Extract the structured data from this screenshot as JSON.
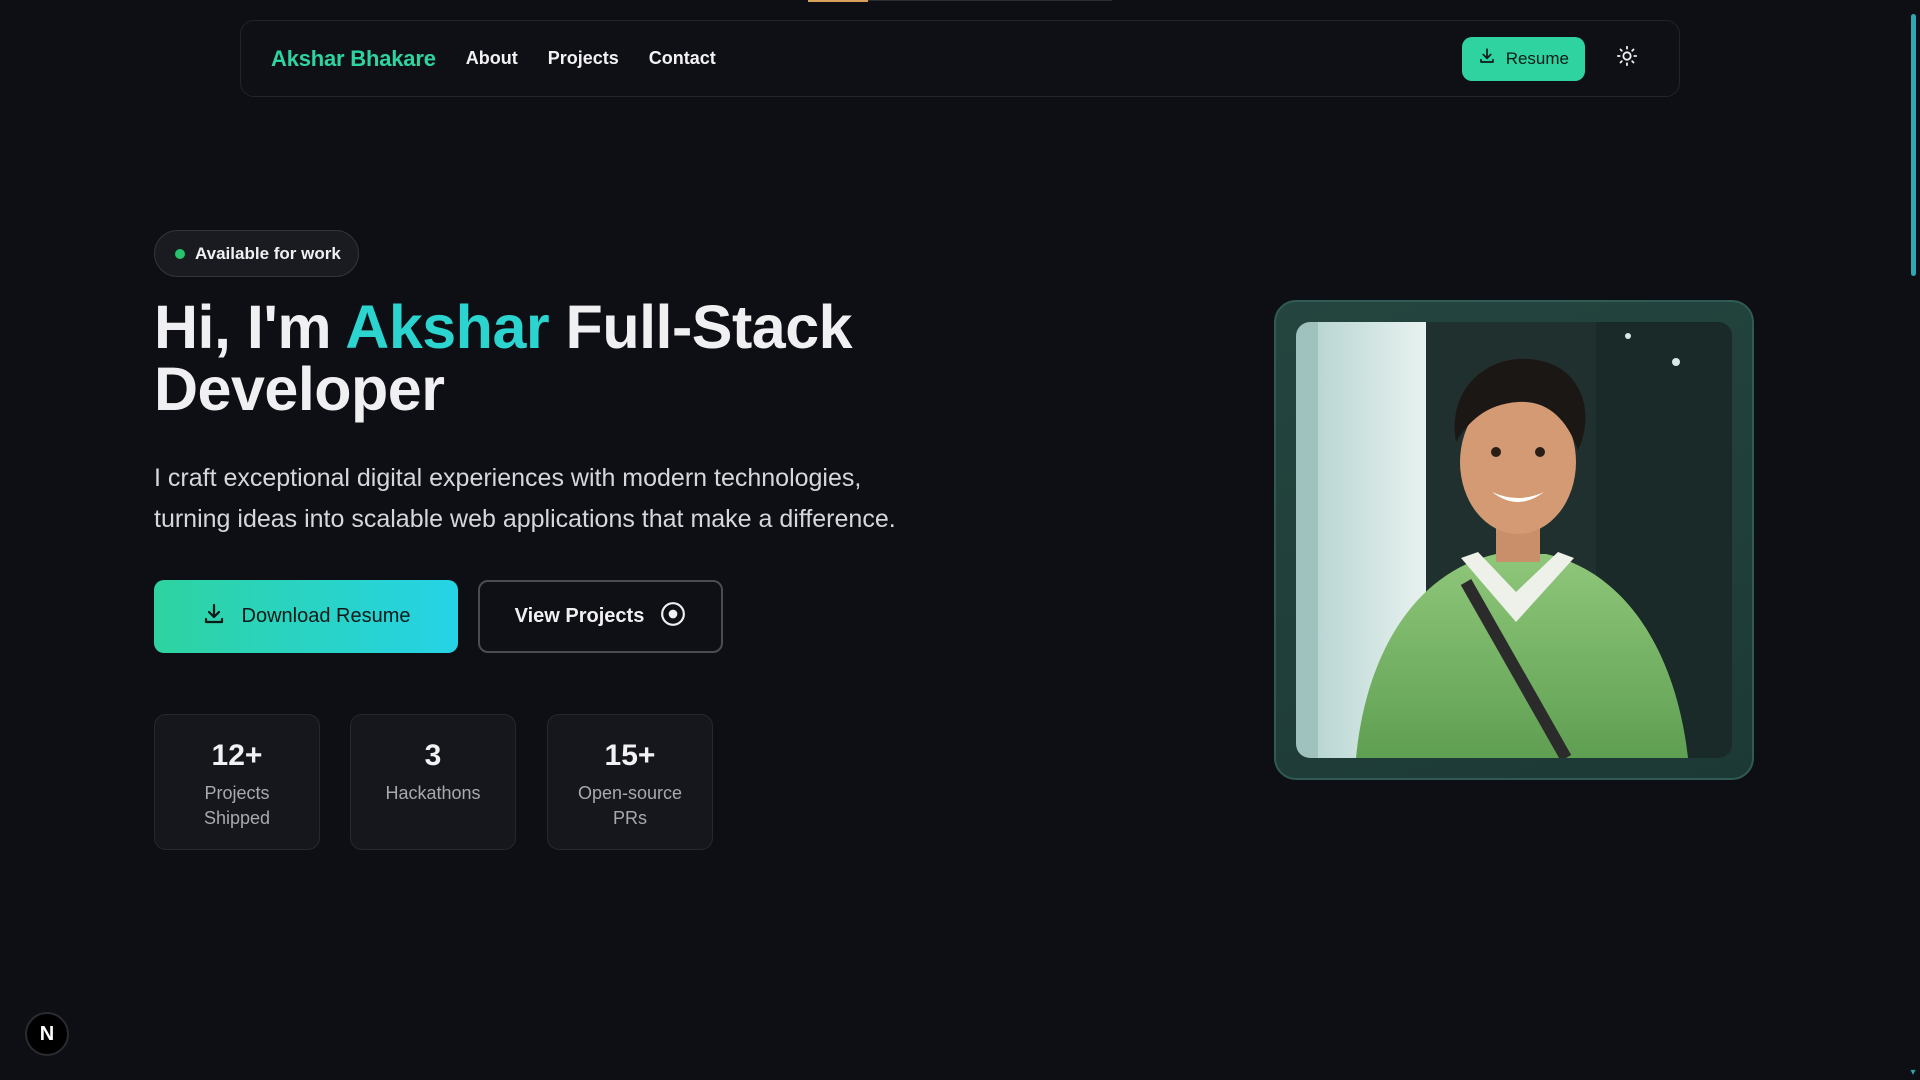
{
  "nav": {
    "brand": "Akshar Bhakare",
    "links": [
      "About",
      "Projects",
      "Contact"
    ],
    "resume_label": "Resume"
  },
  "hero": {
    "badge": "Available for work",
    "title_prefix": "Hi, I'm ",
    "title_accent": "Akshar",
    "title_suffix": " Full-Stack Developer",
    "subtitle": "I craft exceptional digital experiences with modern technologies, turning ideas into scalable web applications that make a difference.",
    "primary_cta": "Download Resume",
    "secondary_cta": "View Projects"
  },
  "stats": [
    {
      "value": "12+",
      "label": "Projects Shipped"
    },
    {
      "value": "3",
      "label": "Hackathons"
    },
    {
      "value": "15+",
      "label": "Open-source PRs"
    }
  ],
  "badge_letter": "N",
  "colors": {
    "background": "#0e0f14",
    "brand_green": "#2fd3a0",
    "accent_cyan": "#2cd4d0",
    "available_dot": "#27c36c"
  },
  "icons": {
    "resume": "download-icon",
    "theme": "sun-icon",
    "view_projects": "target-icon"
  }
}
